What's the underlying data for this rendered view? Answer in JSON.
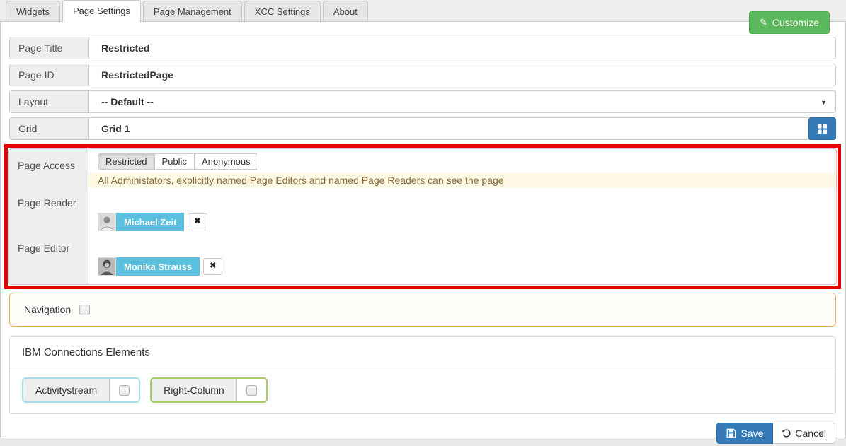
{
  "tabs": [
    {
      "label": "Widgets",
      "active": false
    },
    {
      "label": "Page Settings",
      "active": true
    },
    {
      "label": "Page Management",
      "active": false
    },
    {
      "label": "XCC Settings",
      "active": false
    },
    {
      "label": "About",
      "active": false
    }
  ],
  "toolbar": {
    "customize_label": "Customize"
  },
  "icons": {
    "pencil": "✎",
    "caret": "▼",
    "close": "✖"
  },
  "form": {
    "page_title": {
      "label": "Page Title",
      "value": "Restricted"
    },
    "page_id": {
      "label": "Page ID",
      "value": "RestrictedPage"
    },
    "layout": {
      "label": "Layout",
      "value": "-- Default --"
    },
    "grid": {
      "label": "Grid",
      "value": "Grid 1"
    }
  },
  "access": {
    "page_access_label": "Page Access",
    "page_reader_label": "Page Reader",
    "page_editor_label": "Page Editor",
    "options": [
      {
        "label": "Restricted",
        "selected": true
      },
      {
        "label": "Public",
        "selected": false
      },
      {
        "label": "Anonymous",
        "selected": false
      }
    ],
    "info_message": "All Administators, explicitly named Page Editors and named Page Readers can see the page",
    "reader_chip": {
      "name": "Michael Zeit"
    },
    "editor_chip": {
      "name": "Monika Strauss"
    }
  },
  "navigation": {
    "label": "Navigation",
    "checked": false
  },
  "connections": {
    "title": "IBM Connections Elements",
    "widgets": [
      {
        "label": "Activitystream",
        "checked": false
      },
      {
        "label": "Right-Column",
        "checked": false
      }
    ]
  },
  "footer": {
    "save_label": "Save",
    "cancel_label": "Cancel"
  },
  "colors": {
    "customize_green": "#5cb85c",
    "primary_blue": "#337ab7",
    "chip_blue": "#5bc0de",
    "highlight_red": "#e60000",
    "navigation_border_orange": "#f0ad4e",
    "info_bg": "#fcf8e3",
    "info_text": "#8a6d3b",
    "activitystream_border": "#aadcec",
    "rightcolumn_border": "#a5cc68"
  }
}
